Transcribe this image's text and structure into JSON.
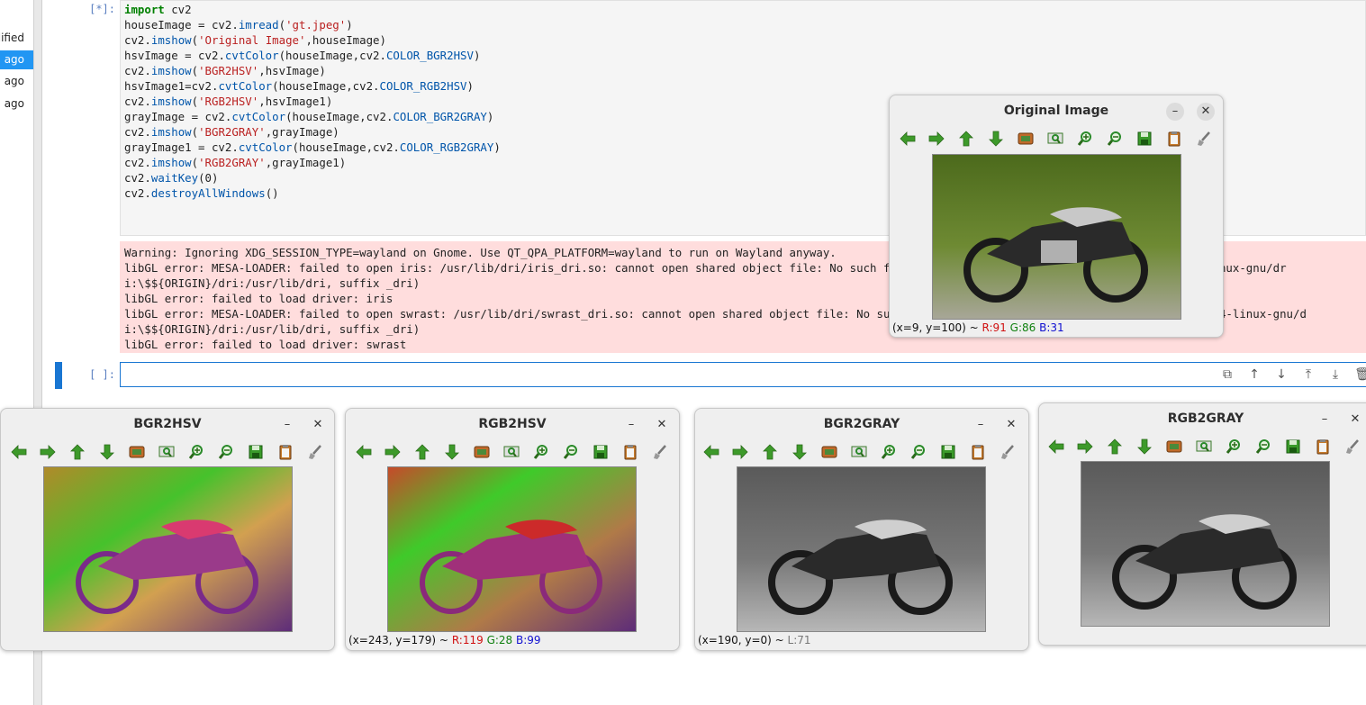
{
  "sidebar": {
    "header_label": "Modified",
    "items": [
      {
        "label": "ago",
        "selected": true
      },
      {
        "label": "ago",
        "selected": false
      },
      {
        "label": "ago",
        "selected": false
      }
    ]
  },
  "notebook": {
    "running_prompt": "[*]:",
    "empty_prompt": "[ ]:",
    "code_lines": [
      "import cv2",
      "houseImage = cv2.imread('gt.jpeg')",
      "cv2.imshow('Original Image',houseImage)",
      "hsvImage = cv2.cvtColor(houseImage,cv2.COLOR_BGR2HSV)",
      "cv2.imshow('BGR2HSV',hsvImage)",
      "hsvImage1=cv2.cvtColor(houseImage,cv2.COLOR_RGB2HSV)",
      "cv2.imshow('RGB2HSV',hsvImage1)",
      "grayImage = cv2.cvtColor(houseImage,cv2.COLOR_BGR2GRAY)",
      "cv2.imshow('BGR2GRAY',grayImage)",
      "grayImage1 = cv2.cvtColor(houseImage,cv2.COLOR_RGB2GRAY)",
      "cv2.imshow('RGB2GRAY',grayImage1)",
      "cv2.waitKey(0)",
      "cv2.destroyAllWindows()"
    ],
    "stderr_lines": [
      "Warning: Ignoring XDG_SESSION_TYPE=wayland on Gnome. Use QT_QPA_PLATFORM=wayland to run on Wayland anyway.",
      "libGL error: MESA-LOADER: failed to open iris: /usr/lib/dri/iris_dri.so: cannot open shared object file: No such file or directory (search paths /usr/lib/x86_64-linux-gnu/dr",
      "i:\\$${ORIGIN}/dri:/usr/lib/dri, suffix _dri)",
      "libGL error: failed to load driver: iris",
      "libGL error: MESA-LOADER: failed to open swrast: /usr/lib/dri/swrast_dri.so: cannot open shared object file: No such file or directory (search paths /usr/lib/x86_64-linux-gnu/d",
      "i:\\$${ORIGIN}/dri:/usr/lib/dri, suffix _dri)",
      "libGL error: failed to load driver: swrast"
    ],
    "cell_tools": [
      "copy-icon",
      "move-up-icon",
      "move-down-icon",
      "insert-above-icon",
      "insert-below-icon",
      "delete-icon"
    ]
  },
  "windows": {
    "original": {
      "title": "Original Image",
      "status": {
        "coords": "(x=9, y=100) ~",
        "r": "R:91",
        "g": "G:86",
        "b": "B:31"
      }
    },
    "bgr2hsv": {
      "title": "BGR2HSV"
    },
    "rgb2hsv": {
      "title": "RGB2HSV",
      "status": {
        "coords": "(x=243, y=179) ~",
        "r": "R:119",
        "g": "G:28",
        "b": "B:99"
      }
    },
    "bgr2gray": {
      "title": "BGR2GRAY",
      "status": {
        "coords": "(x=190, y=0) ~",
        "l": "L:71"
      }
    },
    "rgb2gray": {
      "title": "RGB2GRAY"
    }
  },
  "window_controls": {
    "minimize": "–",
    "close": "✕"
  },
  "toolbar_icons": [
    "pan-left-icon",
    "pan-right-icon",
    "pan-up-icon",
    "pan-down-icon",
    "zoom-fit-icon",
    "zoom-actual-icon",
    "zoom-in-icon",
    "zoom-out-icon",
    "save-icon",
    "copy-clipboard-icon",
    "properties-icon"
  ],
  "colors": {
    "accent": "#1976d2",
    "error_bg": "#ffdddd",
    "toolbar_arrow": "#3d9a2a"
  }
}
